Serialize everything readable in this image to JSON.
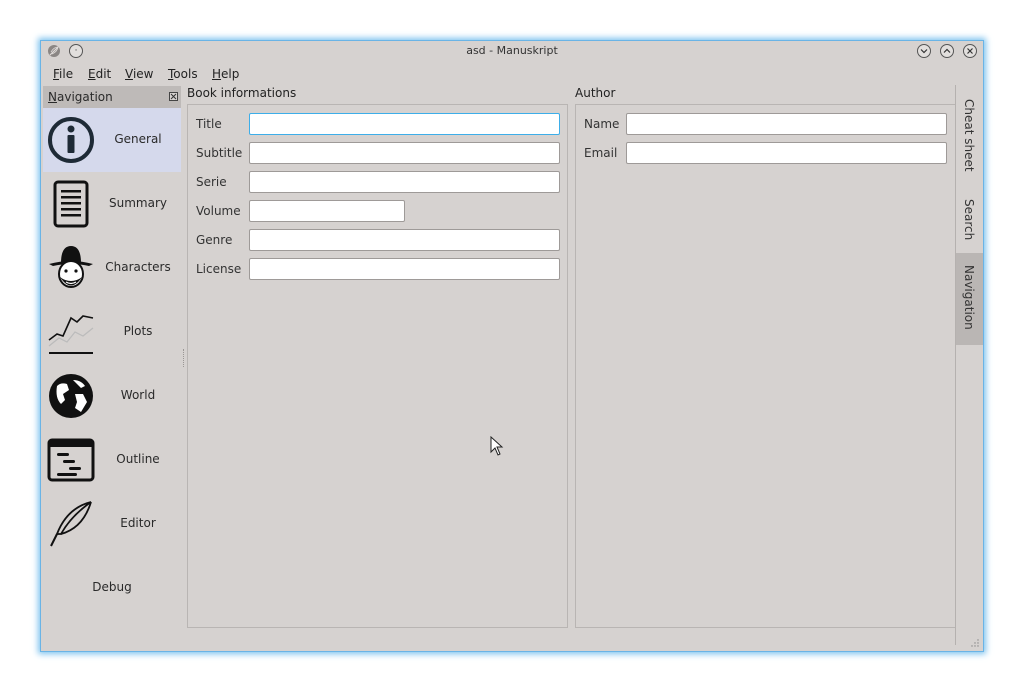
{
  "window": {
    "title": "asd - Manuskript"
  },
  "menu": {
    "items": [
      {
        "label": "File",
        "mnemonic": "F",
        "rest": "ile"
      },
      {
        "label": "Edit",
        "mnemonic": "E",
        "rest": "dit"
      },
      {
        "label": "View",
        "mnemonic": "V",
        "rest": "iew"
      },
      {
        "label": "Tools",
        "mnemonic": "T",
        "rest": "ools"
      },
      {
        "label": "Help",
        "mnemonic": "H",
        "rest": "elp"
      }
    ]
  },
  "navigation": {
    "title": "Navigation",
    "title_mnemonic": "N",
    "title_rest": "avigation",
    "items": [
      {
        "label": "General",
        "icon": "info-icon",
        "selected": true
      },
      {
        "label": "Summary",
        "icon": "document-icon",
        "selected": false
      },
      {
        "label": "Characters",
        "icon": "character-icon",
        "selected": false
      },
      {
        "label": "Plots",
        "icon": "plot-line-icon",
        "selected": false
      },
      {
        "label": "World",
        "icon": "globe-icon",
        "selected": false
      },
      {
        "label": "Outline",
        "icon": "outline-icon",
        "selected": false
      },
      {
        "label": "Editor",
        "icon": "quill-icon",
        "selected": false
      },
      {
        "label": "Debug",
        "icon": "",
        "selected": false
      }
    ]
  },
  "book": {
    "group_title": "Book informations",
    "fields": [
      {
        "label": "Title",
        "value": ""
      },
      {
        "label": "Subtitle",
        "value": ""
      },
      {
        "label": "Serie",
        "value": ""
      },
      {
        "label": "Volume",
        "value": ""
      },
      {
        "label": "Genre",
        "value": ""
      },
      {
        "label": "License",
        "value": ""
      }
    ]
  },
  "author": {
    "group_title": "Author",
    "fields": [
      {
        "label": "Name",
        "value": ""
      },
      {
        "label": "Email",
        "value": ""
      }
    ]
  },
  "side_tabs": {
    "items": [
      {
        "label": "Cheat sheet",
        "active": false
      },
      {
        "label": "Search",
        "active": false
      },
      {
        "label": "Navigation",
        "active": true
      }
    ]
  },
  "colors": {
    "window_bg": "#d6d2d0",
    "selection_bg": "#d5d9ec",
    "focus_border": "#3daee9",
    "window_border_glow": "#7ec3ee"
  }
}
